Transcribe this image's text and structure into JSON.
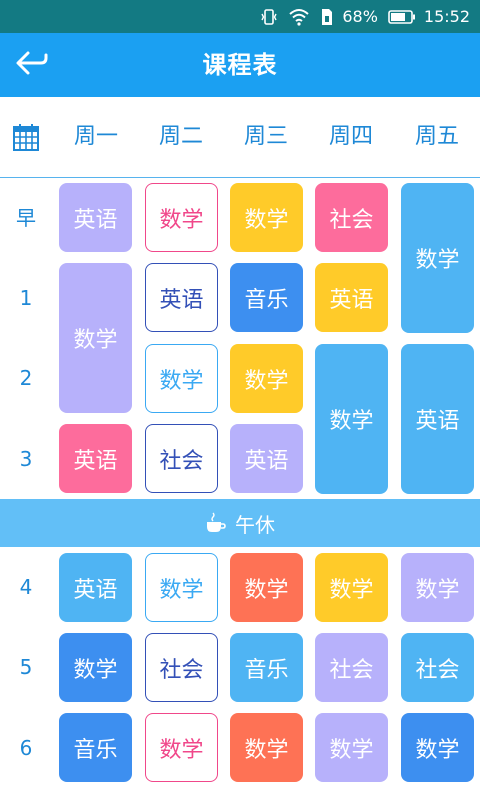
{
  "status_bar": {
    "battery": "68%",
    "time": "15:52"
  },
  "app_bar": {
    "title": "课程表"
  },
  "weekdays": [
    "周一",
    "周二",
    "周三",
    "周四",
    "周五"
  ],
  "rows": [
    "早",
    "1",
    "2",
    "3",
    "4",
    "5",
    "6"
  ],
  "lunch": {
    "label": "午休"
  },
  "colors": {
    "purple": "#b7b1fb",
    "pink": "#fd6c9c",
    "yellow": "#ffcb29",
    "blue": "#3d8ff0",
    "lightblue": "#4fb4f3",
    "orange": "#fe7255",
    "outline_pink": "#f0478a",
    "outline_navy": "#3350b7",
    "outline_sky": "#3aa9f3"
  },
  "courses": [
    {
      "day": 0,
      "start": 0,
      "span": 1,
      "name": "英语",
      "style": "purple"
    },
    {
      "day": 0,
      "start": 1,
      "span": 2,
      "name": "数学",
      "style": "purple"
    },
    {
      "day": 0,
      "start": 3,
      "span": 1,
      "name": "英语",
      "style": "pink"
    },
    {
      "day": 0,
      "start": 4,
      "span": 1,
      "name": "英语",
      "style": "lightblue"
    },
    {
      "day": 0,
      "start": 5,
      "span": 1,
      "name": "数学",
      "style": "blue"
    },
    {
      "day": 0,
      "start": 6,
      "span": 1,
      "name": "音乐",
      "style": "blue"
    },
    {
      "day": 1,
      "start": 0,
      "span": 1,
      "name": "数学",
      "style": "outline_pink"
    },
    {
      "day": 1,
      "start": 1,
      "span": 1,
      "name": "英语",
      "style": "outline_navy"
    },
    {
      "day": 1,
      "start": 2,
      "span": 1,
      "name": "数学",
      "style": "outline_sky"
    },
    {
      "day": 1,
      "start": 3,
      "span": 1,
      "name": "社会",
      "style": "outline_navy"
    },
    {
      "day": 1,
      "start": 4,
      "span": 1,
      "name": "数学",
      "style": "outline_sky"
    },
    {
      "day": 1,
      "start": 5,
      "span": 1,
      "name": "社会",
      "style": "outline_navy"
    },
    {
      "day": 1,
      "start": 6,
      "span": 1,
      "name": "数学",
      "style": "outline_pink"
    },
    {
      "day": 2,
      "start": 0,
      "span": 1,
      "name": "数学",
      "style": "yellow"
    },
    {
      "day": 2,
      "start": 1,
      "span": 1,
      "name": "音乐",
      "style": "blue"
    },
    {
      "day": 2,
      "start": 2,
      "span": 1,
      "name": "数学",
      "style": "yellow"
    },
    {
      "day": 2,
      "start": 3,
      "span": 1,
      "name": "英语",
      "style": "purple"
    },
    {
      "day": 2,
      "start": 4,
      "span": 1,
      "name": "数学",
      "style": "orange"
    },
    {
      "day": 2,
      "start": 5,
      "span": 1,
      "name": "音乐",
      "style": "lightblue"
    },
    {
      "day": 2,
      "start": 6,
      "span": 1,
      "name": "数学",
      "style": "orange"
    },
    {
      "day": 3,
      "start": 0,
      "span": 1,
      "name": "社会",
      "style": "pink"
    },
    {
      "day": 3,
      "start": 1,
      "span": 1,
      "name": "英语",
      "style": "yellow"
    },
    {
      "day": 3,
      "start": 2,
      "span": 2,
      "name": "数学",
      "style": "lightblue"
    },
    {
      "day": 3,
      "start": 4,
      "span": 1,
      "name": "数学",
      "style": "yellow"
    },
    {
      "day": 3,
      "start": 5,
      "span": 1,
      "name": "社会",
      "style": "purple"
    },
    {
      "day": 3,
      "start": 6,
      "span": 1,
      "name": "数学",
      "style": "purple"
    },
    {
      "day": 4,
      "start": 0,
      "span": 2,
      "name": "数学",
      "style": "lightblue"
    },
    {
      "day": 4,
      "start": 2,
      "span": 2,
      "name": "英语",
      "style": "lightblue"
    },
    {
      "day": 4,
      "start": 4,
      "span": 1,
      "name": "数学",
      "style": "purple"
    },
    {
      "day": 4,
      "start": 5,
      "span": 1,
      "name": "社会",
      "style": "lightblue"
    },
    {
      "day": 4,
      "start": 6,
      "span": 1,
      "name": "数学",
      "style": "blue"
    }
  ]
}
